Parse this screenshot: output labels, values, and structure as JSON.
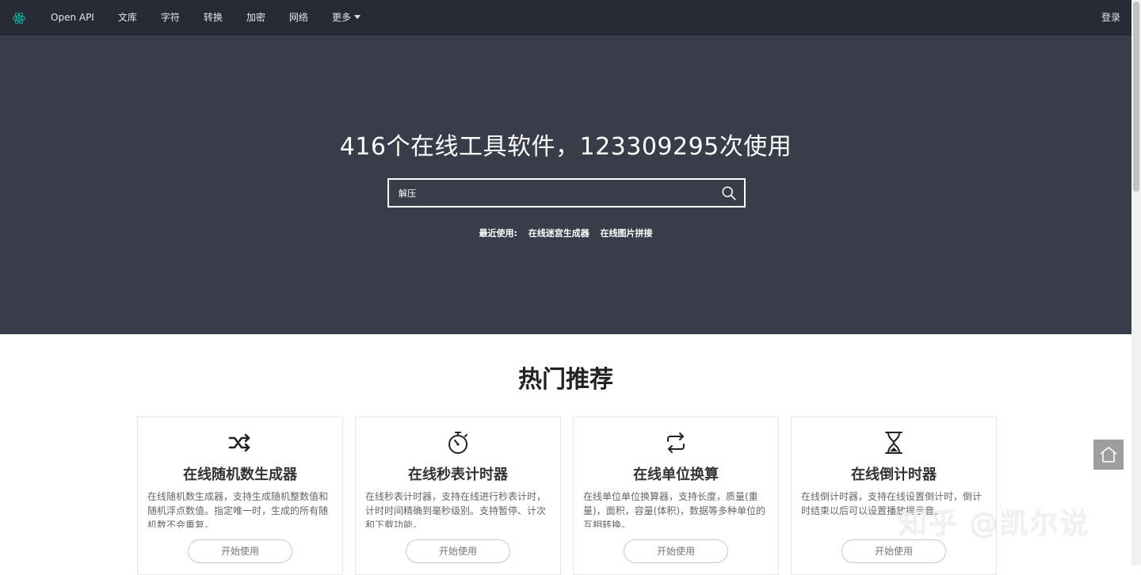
{
  "nav": {
    "logo_icon": "atom-icon",
    "items": [
      {
        "label": "Open API"
      },
      {
        "label": "文库"
      },
      {
        "label": "字符"
      },
      {
        "label": "转换"
      },
      {
        "label": "加密"
      },
      {
        "label": "网络"
      },
      {
        "label": "更多"
      }
    ],
    "login": "登录"
  },
  "hero": {
    "title": "416个在线工具软件，123309295次使用",
    "search": {
      "value": "解压",
      "icon": "search-icon"
    },
    "recent_label": "最近使用:",
    "recent_links": [
      "在线迷宫生成器",
      "在线图片拼接"
    ]
  },
  "section": {
    "title": "热门推荐"
  },
  "cards": [
    {
      "icon": "shuffle-icon",
      "title": "在线随机数生成器",
      "desc": "在线随机数生成器，支持生成随机整数值和随机浮点数值。指定唯一时，生成的所有随机数不会重复。",
      "button": "开始使用"
    },
    {
      "icon": "stopwatch-icon",
      "title": "在线秒表计时器",
      "desc": "在线秒表计时器，支持在线进行秒表计时，计时时间精确到毫秒级别。支持暂停、计次和下载功能。",
      "button": "开始使用"
    },
    {
      "icon": "repeat-icon",
      "title": "在线单位换算",
      "desc": "在线单位单位换算器，支持长度，质量(重量)，面积，容量(体积)，数据等多种单位的互相转换。",
      "button": "开始使用"
    },
    {
      "icon": "hourglass-icon",
      "title": "在线倒计时器",
      "desc": "在线倒计时器，支持在线设置倒计时，倒计时结束以后可以设置播放提示音。",
      "button": "开始使用"
    }
  ],
  "watermark": "知乎 @凯尔说",
  "colors": {
    "nav_bg": "#262a34",
    "hero_bg": "#393d49",
    "logo": "#1aa094"
  }
}
